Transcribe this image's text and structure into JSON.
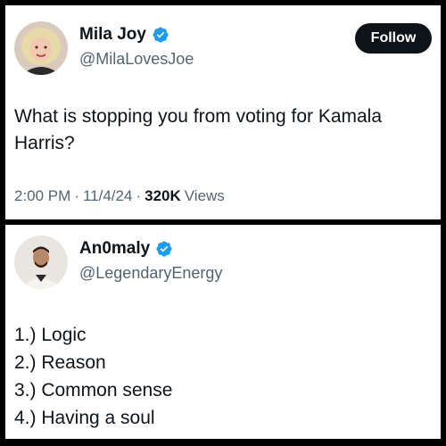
{
  "tweet": {
    "author_name": "Mila Joy",
    "author_handle": "@MilaLovesJoe",
    "follow_label": "Follow",
    "text": "What is stopping you from voting for Kamala Harris?",
    "time": "2:00 PM",
    "sep1": "·",
    "date": "11/4/24",
    "sep2": "·",
    "views_count": "320K",
    "views_label": "Views"
  },
  "reply": {
    "author_name": "An0maly",
    "author_handle": "@LegendaryEnergy",
    "items": [
      "1.) Logic",
      "2.) Reason",
      "3.) Common sense",
      "4.) Having a soul"
    ]
  },
  "colors": {
    "verified_blue": "#1d9bf0",
    "text_primary": "#0f1419",
    "text_secondary": "#536471"
  },
  "icons": {
    "verified": "verified-badge-icon"
  }
}
